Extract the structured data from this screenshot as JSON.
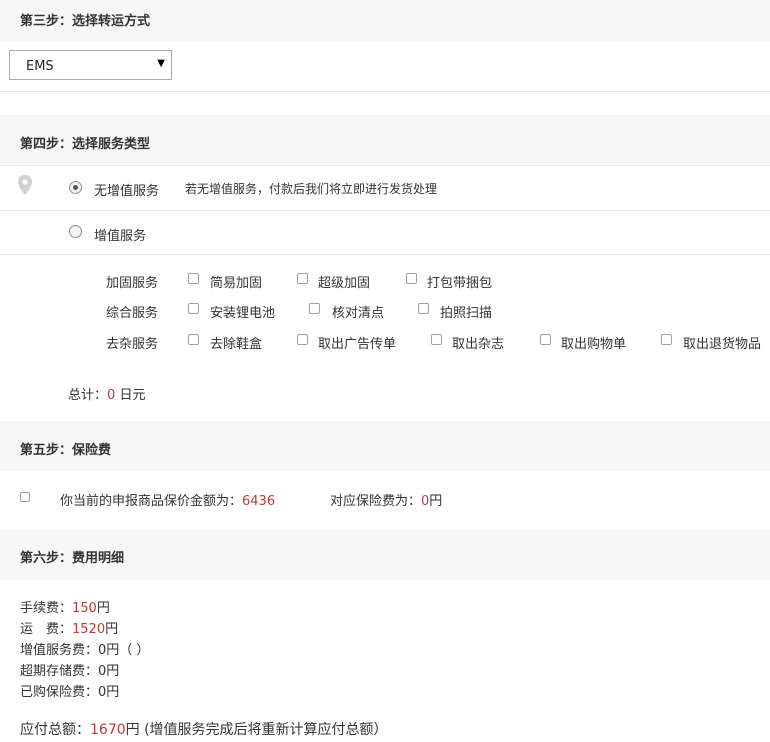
{
  "step3": {
    "title": "第三步：选择转运方式",
    "selected": "EMS"
  },
  "step4": {
    "title": "第四步：选择服务类型",
    "no_value_added": "无增值服务",
    "no_value_added_note": "若无增值服务，付款后我们将立即进行发货处理",
    "value_added": "增值服务",
    "groups": [
      {
        "label": "加固服务",
        "options": [
          "简易加固",
          "超级加固",
          "打包带捆包"
        ]
      },
      {
        "label": "综合服务",
        "options": [
          "安装锂电池",
          "核对清点",
          "拍照扫描"
        ]
      },
      {
        "label": "去杂服务",
        "options": [
          "去除鞋盒",
          "取出广告传单",
          "取出杂志",
          "取出购物单",
          "取出退货物品"
        ]
      }
    ],
    "total_label": "总计：",
    "total_value": "0",
    "total_unit": "日元"
  },
  "step5": {
    "title": "第五步：保险费",
    "declared_label": "你当前的申报商品保价金额为：",
    "declared_value": "6436",
    "fee_label": "对应保险费为：",
    "fee_value": "0",
    "fee_unit": "円"
  },
  "step6": {
    "title": "第六步：费用明细",
    "handling_label": "手续费：",
    "handling_value": "150",
    "shipping_label": "运　费：",
    "shipping_value": "1520",
    "value_added_label": "增值服务费：",
    "value_added_value": "0円（ ）",
    "storage_label": "超期存储费：",
    "storage_value": "0円",
    "insurance_label": "已购保险费：",
    "insurance_value": "0円",
    "unit": "円",
    "total_label": "应付总额：",
    "total_value": "1670",
    "total_note": "(增值服务完成后将重新计算应付总额）"
  },
  "colors": {
    "band": "#f7f7f7",
    "accent": "#b5403a",
    "text": "#333333"
  },
  "icons": {
    "location": "location-pin-icon",
    "dropdown": "chevron-down-icon"
  }
}
